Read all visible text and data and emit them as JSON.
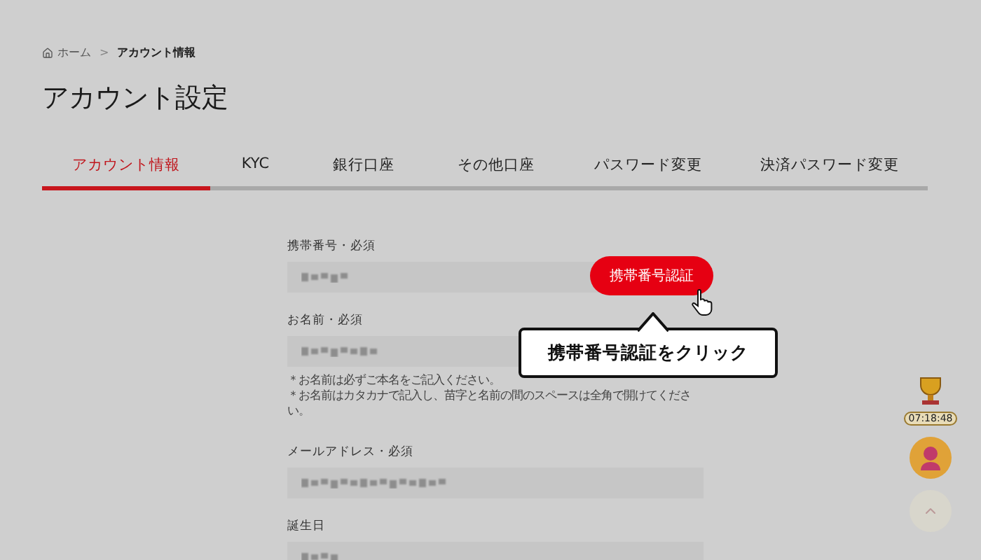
{
  "breadcrumb": [
    {
      "label": "ホーム",
      "selected": false
    },
    {
      "label": "アカウント情報",
      "selected": true
    }
  ],
  "breadcrumb_separator": ">",
  "title": "アカウント設定",
  "tabs": [
    {
      "label": "アカウント情報",
      "selected": true
    },
    {
      "label": "KYC",
      "selected": false
    },
    {
      "label": "銀行口座",
      "selected": false
    },
    {
      "label": "その他口座",
      "selected": false
    },
    {
      "label": "パスワード変更",
      "selected": false
    },
    {
      "label": "決済パスワード変更",
      "selected": false
    }
  ],
  "fields": [
    {
      "label": "携帯番号・必須",
      "action": "携帯番号認証"
    },
    {
      "label": "お名前・必須",
      "notes": [
        "＊お名前は必ずご本名をご記入ください。",
        "＊お名前はカタカナで記入し、苗字と名前の間のスペースは全角で開けてください。"
      ]
    },
    {
      "label": "メールアドレス・必須"
    },
    {
      "label": "誕生日"
    }
  ],
  "callout": "携帯番号認証をクリック",
  "widgets": {
    "timer": "07:18:48"
  }
}
